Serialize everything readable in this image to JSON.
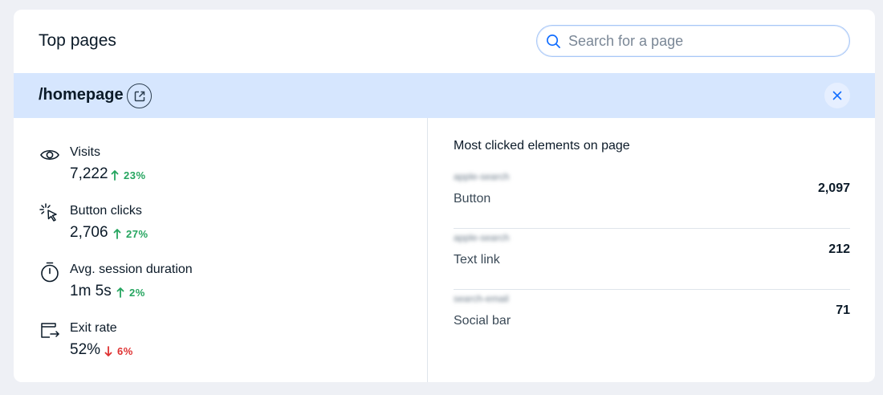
{
  "header": {
    "title": "Top pages",
    "search_placeholder": "Search for a page"
  },
  "selected_page": {
    "path": "/homepage",
    "open_icon": "external-link-icon",
    "close_icon": "close-icon"
  },
  "metrics": [
    {
      "icon": "eye-icon",
      "label": "Visits",
      "value": "7,222",
      "trend": "23%",
      "direction": "up"
    },
    {
      "icon": "cursor-click-icon",
      "label": "Button clicks",
      "value": "2,706",
      "trend": "27%",
      "direction": "up"
    },
    {
      "icon": "stopwatch-icon",
      "label": "Avg. session duration",
      "value": "1m 5s",
      "trend": "2%",
      "direction": "up"
    },
    {
      "icon": "exit-icon",
      "label": "Exit rate",
      "value": "52%",
      "trend": "6%",
      "direction": "down"
    }
  ],
  "clicked_elements": {
    "title": "Most clicked elements on page",
    "items": [
      {
        "blurred_name": "apple-search",
        "type": "Button",
        "count": "2,097"
      },
      {
        "blurred_name": "apple-search",
        "type": "Text link",
        "count": "212"
      },
      {
        "blurred_name": "search-email",
        "type": "Social bar",
        "count": "71"
      }
    ]
  },
  "colors": {
    "accent": "#116dff",
    "trend_up": "#25a55f",
    "trend_down": "#df3131",
    "selected_bar": "#d6e6fe",
    "page_background": "#eef0f5"
  }
}
